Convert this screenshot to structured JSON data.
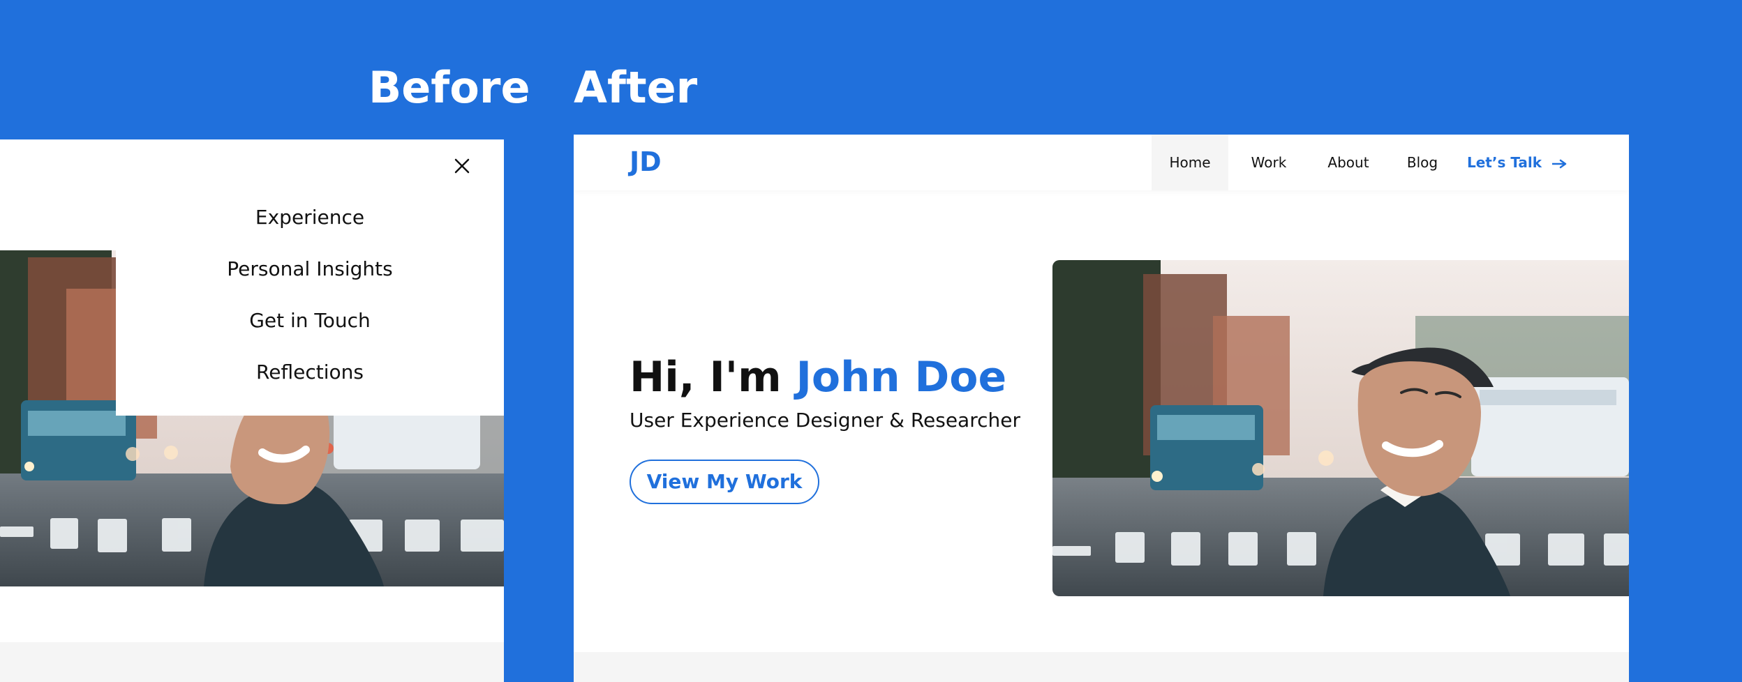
{
  "labels": {
    "before": "Before",
    "after": "After"
  },
  "before": {
    "menu_items": [
      "Experience",
      "Personal Insights",
      "Get in Touch",
      "Reflections"
    ],
    "close_icon": "close-icon"
  },
  "after": {
    "logo": "JD",
    "nav": {
      "home": "Home",
      "work": "Work",
      "about": "About",
      "blog": "Blog",
      "talk": "Let’s Talk"
    },
    "hero": {
      "greeting": "Hi, I'm ",
      "name": "John Doe",
      "subtitle": "User Experience Designer & Researcher",
      "cta": "View My Work"
    }
  },
  "colors": {
    "brand_blue": "#2070DC",
    "text": "#111111",
    "white": "#FFFFFF",
    "light_gray": "#F5F5F5"
  },
  "icons": [
    "close-icon",
    "arrow-right-icon"
  ]
}
